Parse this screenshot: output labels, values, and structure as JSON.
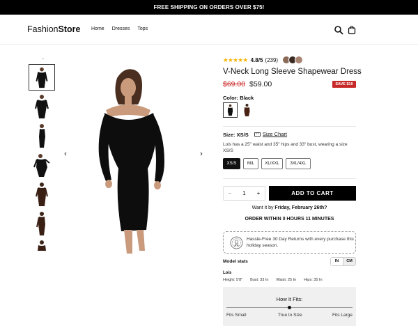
{
  "promo": {
    "text": "FREE SHIPPING ON ORDERS OVER $75!"
  },
  "header": {
    "logo_regular": "Fashion",
    "logo_bold": "Store",
    "nav": [
      "Home",
      "Dresses",
      "Tops"
    ],
    "icons": [
      "search-icon",
      "shopping-bag-icon"
    ]
  },
  "gallery": {
    "thumbnails": [
      "front-black",
      "front-black-alt",
      "side-black",
      "pose-black",
      "brown-front",
      "brown-side",
      "brown-crop"
    ],
    "active_thumbnail": 0,
    "arrows": [
      "chevron-left-icon",
      "chevron-right-icon"
    ]
  },
  "product": {
    "stars": "★★★★★",
    "rating": "4.8/5",
    "review_count": "(239)",
    "title": "V-Neck Long Sleeve Shapewear Dress",
    "price_old": "$69.00",
    "price_new": "$59.00",
    "save_badge": "SAVE $10",
    "color_label": "Color:",
    "color_value": "Black",
    "colors": [
      "Black",
      "Brown"
    ],
    "size_label": "Size:",
    "size_value": "XS/S",
    "size_chart": "Size Chart",
    "size_note": "Lois has a 25\" waist and 35\" hips and 33\" bust, wearing a size XS/S",
    "sizes": [
      "XS/S",
      "M/L",
      "XL/XXL",
      "3XL/4XL"
    ],
    "selected_size": "XS/S",
    "qty_minus": "−",
    "qty_value": "1",
    "qty_plus": "+",
    "add_to_cart": "ADD TO CART",
    "want_prefix": "Want it by ",
    "want_date": "Friday, February 26th?",
    "order_within": "ORDER WITHIN 0 HOURS 11 MINUTES",
    "returns_bold": "Hassle-Free 30 Day Returns",
    "returns_rest": " with every purchase this holiday season."
  },
  "model": {
    "stats_label": "Model stats",
    "units": [
      "IN",
      "CM"
    ],
    "name": "Lois",
    "measurements": [
      "Height: 5'8\"",
      "Bust: 33 In",
      "Waist: 25 In",
      "Hips: 35 In"
    ]
  },
  "fit": {
    "title": "How It Fits:",
    "labels": [
      "Fits Small",
      "True to Size",
      "Fits Large"
    ],
    "value": 0.5
  },
  "colors": {
    "accent": "#000000",
    "sale_red": "#c62828",
    "star": "#f5b301"
  }
}
